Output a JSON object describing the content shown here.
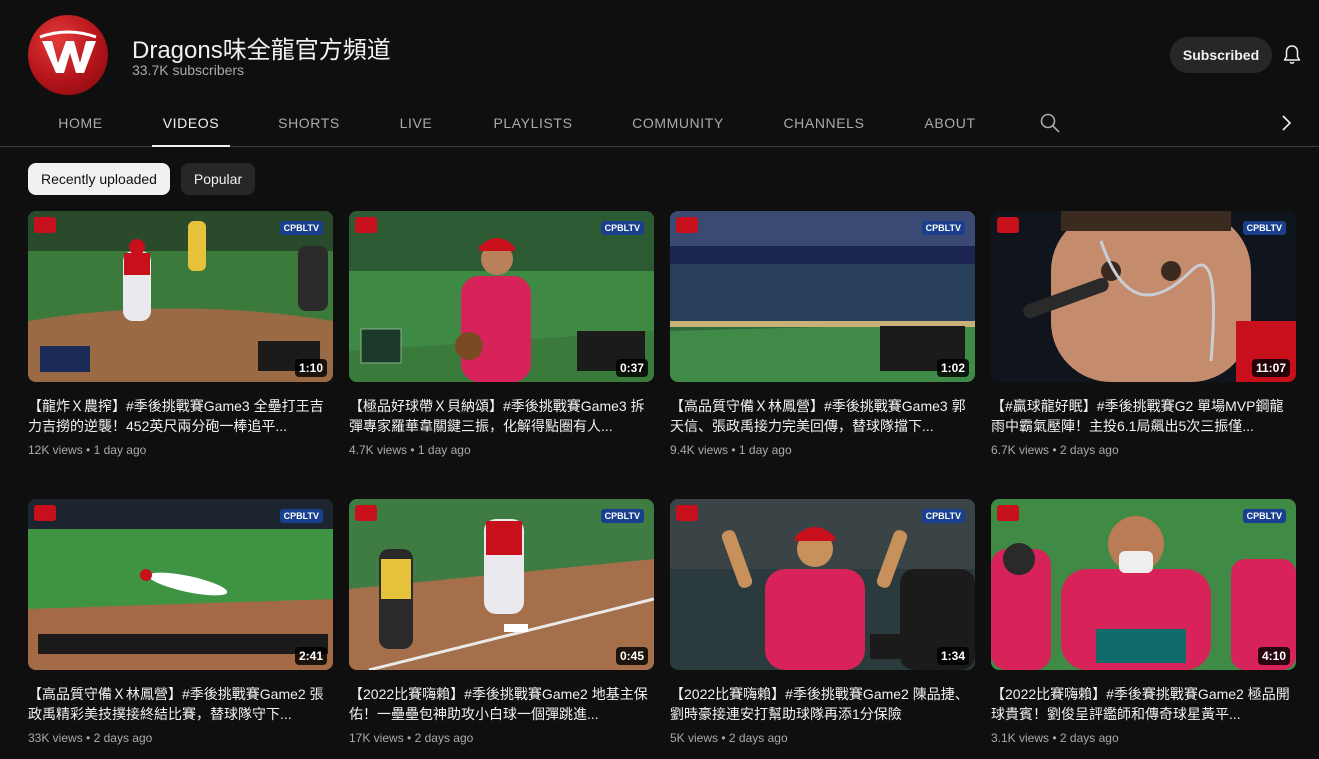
{
  "channel": {
    "name": "Dragons味全龍官方頻道",
    "subscribers": "33.7K subscribers",
    "subscribe_label": "Subscribed",
    "brand_color": "#c8101c"
  },
  "tabs": [
    {
      "label": "HOME"
    },
    {
      "label": "VIDEOS"
    },
    {
      "label": "SHORTS"
    },
    {
      "label": "LIVE"
    },
    {
      "label": "PLAYLISTS"
    },
    {
      "label": "COMMUNITY"
    },
    {
      "label": "CHANNELS"
    },
    {
      "label": "ABOUT"
    }
  ],
  "chips": [
    {
      "label": "Recently uploaded"
    },
    {
      "label": "Popular"
    }
  ],
  "videos": [
    {
      "title": "【龍炸Ｘ農搾】#季後挑戰賽Game3 全壘打王吉力吉撈的逆襲！452英尺兩分砲一棒追平...",
      "views": "12K views",
      "sep": "•",
      "age": "1 day ago",
      "duration": "1:10"
    },
    {
      "title": "【極品好球帶Ｘ貝納頌】#季後挑戰賽Game3 拆彈專家羅華韋關鍵三振，化解得點圈有人...",
      "views": "4.7K views",
      "sep": "•",
      "age": "1 day ago",
      "duration": "0:37"
    },
    {
      "title": "【高品質守備Ｘ林鳳營】#季後挑戰賽Game3 郭天信、張政禹接力完美回傳，替球隊擋下...",
      "views": "9.4K views",
      "sep": "•",
      "age": "1 day ago",
      "duration": "1:02"
    },
    {
      "title": "【#贏球龍好眠】#季後挑戰賽G2 單場MVP鋼龍雨中霸氣壓陣！主投6.1局飆出5次三振僅...",
      "views": "6.7K views",
      "sep": "•",
      "age": "2 days ago",
      "duration": "11:07"
    },
    {
      "title": "【高品質守備Ｘ林鳳營】#季後挑戰賽Game2 張政禹精彩美技撲接終結比賽，替球隊守下...",
      "views": "33K views",
      "sep": "•",
      "age": "2 days ago",
      "duration": "2:41"
    },
    {
      "title": "【2022比賽嗨賴】#季後挑戰賽Game2 地基主保佑！一壘壘包神助攻小白球一個彈跳進...",
      "views": "17K views",
      "sep": "•",
      "age": "2 days ago",
      "duration": "0:45"
    },
    {
      "title": "【2022比賽嗨賴】#季後挑戰賽Game2 陳品捷、劉時豪接連安打幫助球隊再添1分保險",
      "views": "5K views",
      "sep": "•",
      "age": "2 days ago",
      "duration": "1:34"
    },
    {
      "title": "【2022比賽嗨賴】#季後賽挑戰賽Game2 極品開球貴賓！劉俊呈評鑑師和傳奇球星黃平...",
      "views": "3.1K views",
      "sep": "•",
      "age": "2 days ago",
      "duration": "4:10"
    }
  ],
  "thumb_brand": "CPBLTV"
}
